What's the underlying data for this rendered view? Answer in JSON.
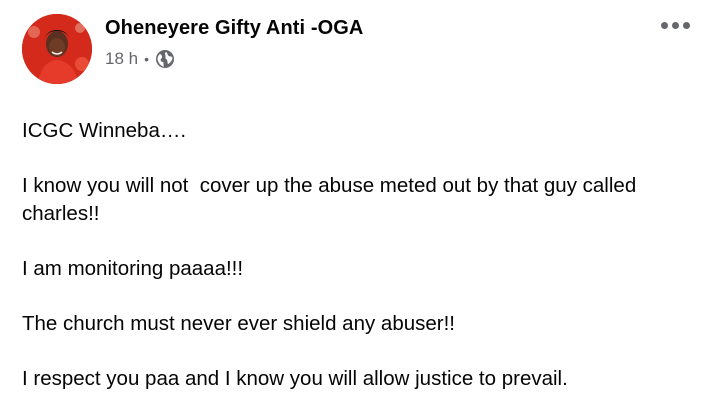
{
  "post": {
    "author": "Oheneyere Gifty Anti -OGA",
    "timestamp": "18 h",
    "separator": "•",
    "audience_icon": "globe-icon",
    "more_icon": "more-options-icon",
    "paragraphs": [
      "ICGC Winneba….",
      "I know you will not  cover up the abuse meted out by that guy called charles!!",
      "I am monitoring paaaa!!!",
      "The church must never ever shield any abuser!!",
      "I respect you paa and I know you will allow justice to prevail."
    ]
  },
  "colors": {
    "text": "#050505",
    "secondary_text": "#65676b",
    "avatar_background": "#c81e12"
  }
}
